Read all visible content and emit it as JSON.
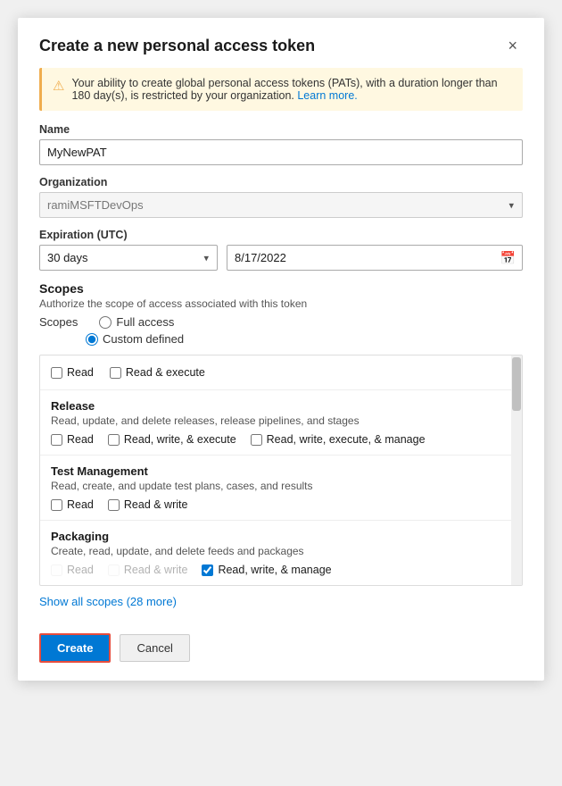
{
  "dialog": {
    "title": "Create a new personal access token",
    "close_label": "×"
  },
  "warning": {
    "text": "Your ability to create global personal access tokens (PATs), with a duration longer than 180 day(s), is restricted by your organization.",
    "link_text": "Learn more.",
    "icon": "⚠"
  },
  "name_field": {
    "label": "Name",
    "value": "MyNewPAT",
    "placeholder": ""
  },
  "organization_field": {
    "label": "Organization",
    "value": "ramiMSFTDevOps",
    "placeholder": "ramiMSFTDevOps"
  },
  "expiration_field": {
    "label": "Expiration (UTC)",
    "days_value": "30 days",
    "date_value": "8/17/2022"
  },
  "scopes_section": {
    "title": "Scopes",
    "description": "Authorize the scope of access associated with this token",
    "scopes_label": "Scopes",
    "full_access_label": "Full access",
    "custom_defined_label": "Custom defined"
  },
  "partial_row": {
    "read_label": "Read",
    "read_execute_label": "Read & execute"
  },
  "scope_blocks": [
    {
      "title": "Release",
      "description": "Read, update, and delete releases, release pipelines, and stages",
      "options": [
        {
          "label": "Read",
          "checked": false,
          "disabled": false
        },
        {
          "label": "Read, write, & execute",
          "checked": false,
          "disabled": false
        },
        {
          "label": "Read, write, execute, & manage",
          "checked": false,
          "disabled": false
        }
      ]
    },
    {
      "title": "Test Management",
      "description": "Read, create, and update test plans, cases, and results",
      "options": [
        {
          "label": "Read",
          "checked": false,
          "disabled": false
        },
        {
          "label": "Read & write",
          "checked": false,
          "disabled": false
        }
      ]
    },
    {
      "title": "Packaging",
      "description": "Create, read, update, and delete feeds and packages",
      "options": [
        {
          "label": "Read",
          "checked": false,
          "disabled": true
        },
        {
          "label": "Read & write",
          "checked": false,
          "disabled": true
        },
        {
          "label": "Read, write, & manage",
          "checked": true,
          "disabled": false
        }
      ]
    }
  ],
  "show_all": {
    "label": "Show all scopes",
    "count": "(28 more)"
  },
  "footer": {
    "create_label": "Create",
    "cancel_label": "Cancel"
  }
}
